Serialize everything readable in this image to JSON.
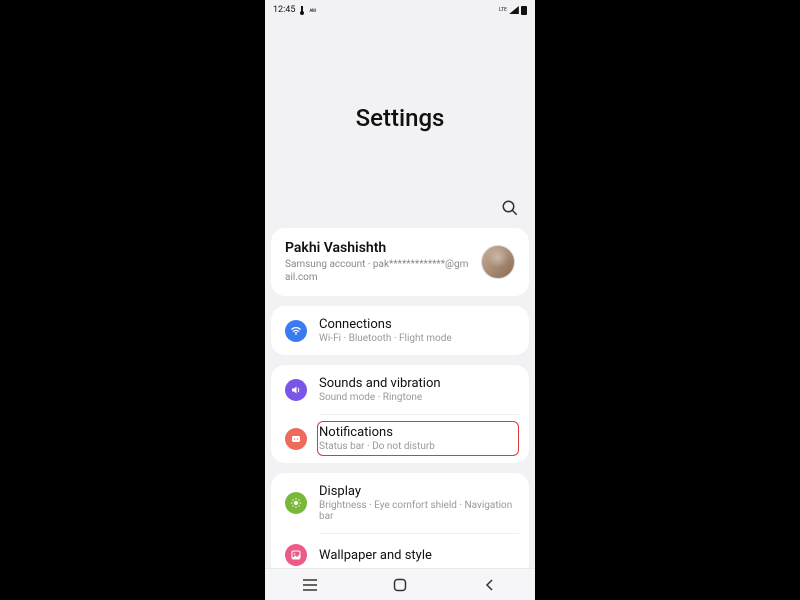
{
  "status": {
    "time": "12:45",
    "netLabel": "LTE"
  },
  "page": {
    "title": "Settings"
  },
  "account": {
    "name": "Pakhi Vashishth",
    "sub": "Samsung account · pak*************@gmail.com"
  },
  "groups": [
    {
      "items": [
        {
          "icon": "wifi",
          "color": "c-blue",
          "title": "Connections",
          "sub": "Wi-Fi · Bluetooth · Flight mode",
          "highlight": false
        }
      ]
    },
    {
      "items": [
        {
          "icon": "sound",
          "color": "c-purple",
          "title": "Sounds and vibration",
          "sub": "Sound mode · Ringtone",
          "highlight": false
        },
        {
          "icon": "notif",
          "color": "c-coral",
          "title": "Notifications",
          "sub": "Status bar · Do not disturb",
          "highlight": true
        }
      ]
    },
    {
      "items": [
        {
          "icon": "display",
          "color": "c-green",
          "title": "Display",
          "sub": "Brightness · Eye comfort shield · Navigation bar",
          "highlight": false
        },
        {
          "icon": "wallpaper",
          "color": "c-pink",
          "title": "Wallpaper and style",
          "sub": "",
          "highlight": false
        }
      ]
    }
  ]
}
